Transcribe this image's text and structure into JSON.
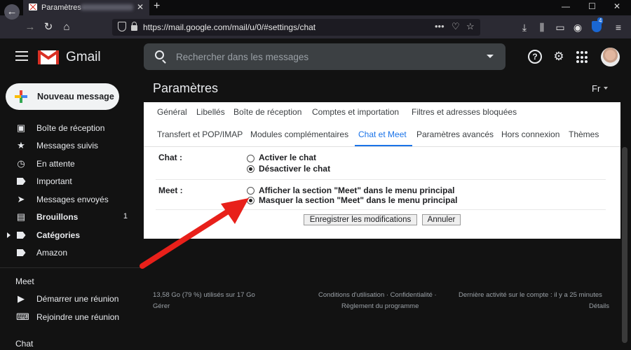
{
  "browser": {
    "tab_title": "Paramètres -",
    "new_tab": "+",
    "win_min": "—",
    "win_max": "☐",
    "win_close": "✕",
    "url": "https://mail.google.com/mail/u/0/#settings/chat",
    "url_more": "•••",
    "ext_badge": "4"
  },
  "gmail": {
    "app_name": "Gmail",
    "search_placeholder": "Rechercher dans les messages",
    "help_glyph": "?",
    "settings_glyph": "⚙"
  },
  "sidebar": {
    "compose": "Nouveau message",
    "items": [
      {
        "label": "Boîte de réception",
        "count": ""
      },
      {
        "label": "Messages suivis",
        "count": ""
      },
      {
        "label": "En attente",
        "count": ""
      },
      {
        "label": "Important",
        "count": ""
      },
      {
        "label": "Messages envoyés",
        "count": ""
      },
      {
        "label": "Brouillons",
        "count": "1"
      },
      {
        "label": "Catégories",
        "count": ""
      },
      {
        "label": "Amazon",
        "count": ""
      }
    ],
    "meet_title": "Meet",
    "meet_items": [
      "Démarrer une réunion",
      "Rejoindre une réunion"
    ],
    "chat_title": "Chat"
  },
  "settings": {
    "title": "Paramètres",
    "lang": "Fr",
    "tabs_row1": [
      "Général",
      "Libellés",
      "Boîte de réception",
      "Comptes et importation",
      "Filtres et adresses bloquées"
    ],
    "tabs_row2": [
      "Transfert et POP/IMAP",
      "Modules complémentaires",
      "Chat et Meet",
      "Paramètres avancés",
      "Hors connexion",
      "Thèmes"
    ],
    "chat_label": "Chat :",
    "chat_options": [
      "Activer le chat",
      "Désactiver le chat"
    ],
    "chat_selected": 1,
    "meet_label": "Meet :",
    "meet_options": [
      "Afficher la section \"Meet\" dans le menu principal",
      "Masquer la section \"Meet\" dans le menu principal"
    ],
    "meet_selected": 1,
    "save_button": "Enregistrer les modifications",
    "cancel_button": "Annuler"
  },
  "footer": {
    "storage": "13,58 Go (79 %) utilisés sur 17 Go",
    "manage": "Gérer",
    "terms": "Conditions d'utilisation · Confidentialité ·",
    "policy": "Règlement du programme",
    "last_activity": "Dernière activité sur le compte : il y a 25 minutes",
    "details": "Détails"
  },
  "colors": {
    "accent": "#1a73e8",
    "arrow": "#e8201a",
    "background": "#121212"
  }
}
